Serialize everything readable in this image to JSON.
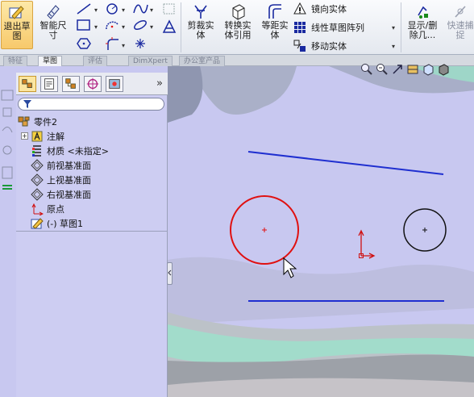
{
  "ribbon": {
    "exit_sketch": "退出草\n图",
    "smart_dimension": "智能尺\n寸",
    "trim_entities": "剪裁实\n体",
    "convert_entities": "转换实\n体引用",
    "offset_entities": "等距实\n体",
    "mirror_entities": "镜向实体",
    "linear_pattern": "线性草图阵列",
    "move_entities": "移动实体",
    "show_delete": "显示/删\n除几...",
    "quick_snaps": "快速捕\n捉"
  },
  "tabs": [
    "特征",
    "草图",
    "评估",
    "DimXpert",
    "办公室产品"
  ],
  "active_tab": "草图",
  "feature_tree": {
    "root": "零件2",
    "items": [
      {
        "label": "注解",
        "icon": "annotations-icon",
        "expandable": true
      },
      {
        "label": "材质 <未指定>",
        "icon": "material-icon"
      },
      {
        "label": "前视基准面",
        "icon": "plane-icon"
      },
      {
        "label": "上视基准面",
        "icon": "plane-icon"
      },
      {
        "label": "右视基准面",
        "icon": "plane-icon"
      },
      {
        "label": "原点",
        "icon": "origin-icon"
      },
      {
        "label": "(-) 草图1",
        "icon": "sketch-icon"
      }
    ]
  },
  "colors": {
    "line_blue": "#1f2fd0",
    "circle_selected": "#e01010",
    "circle_normal": "#111111",
    "origin_red": "#d01010",
    "panel_bg": "#cdcdf2"
  }
}
